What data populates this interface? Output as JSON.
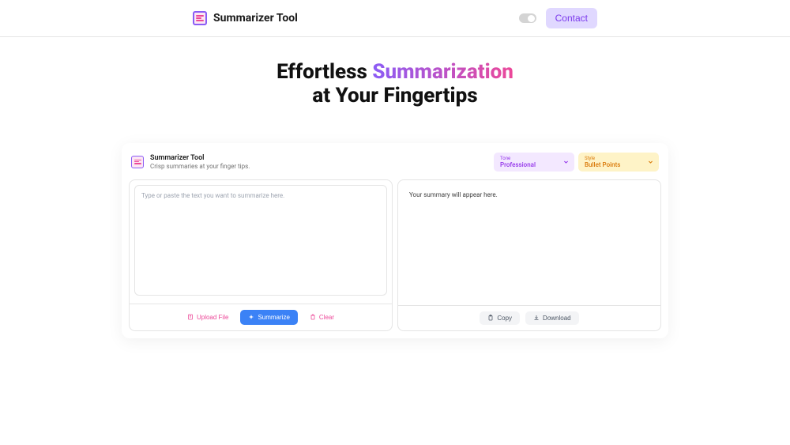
{
  "header": {
    "brand": "Summarizer Tool",
    "contact": "Contact"
  },
  "hero": {
    "line1_pre": "Effortless ",
    "line1_accent": "Summarization",
    "line2": "at Your Fingertips"
  },
  "tool": {
    "title": "Summarizer Tool",
    "subtitle": "Crisp summaries at your finger tips.",
    "tone": {
      "label": "Tone",
      "value": "Professional"
    },
    "style": {
      "label": "Style",
      "value": "Bullet Points"
    },
    "input": {
      "placeholder": "Type or paste the text you want to summarize here."
    },
    "output": {
      "placeholder": "Your summary will appear here."
    },
    "actions": {
      "upload": "Upload File",
      "summarize": "Summarize",
      "clear": "Clear",
      "copy": "Copy",
      "download": "Download"
    }
  }
}
